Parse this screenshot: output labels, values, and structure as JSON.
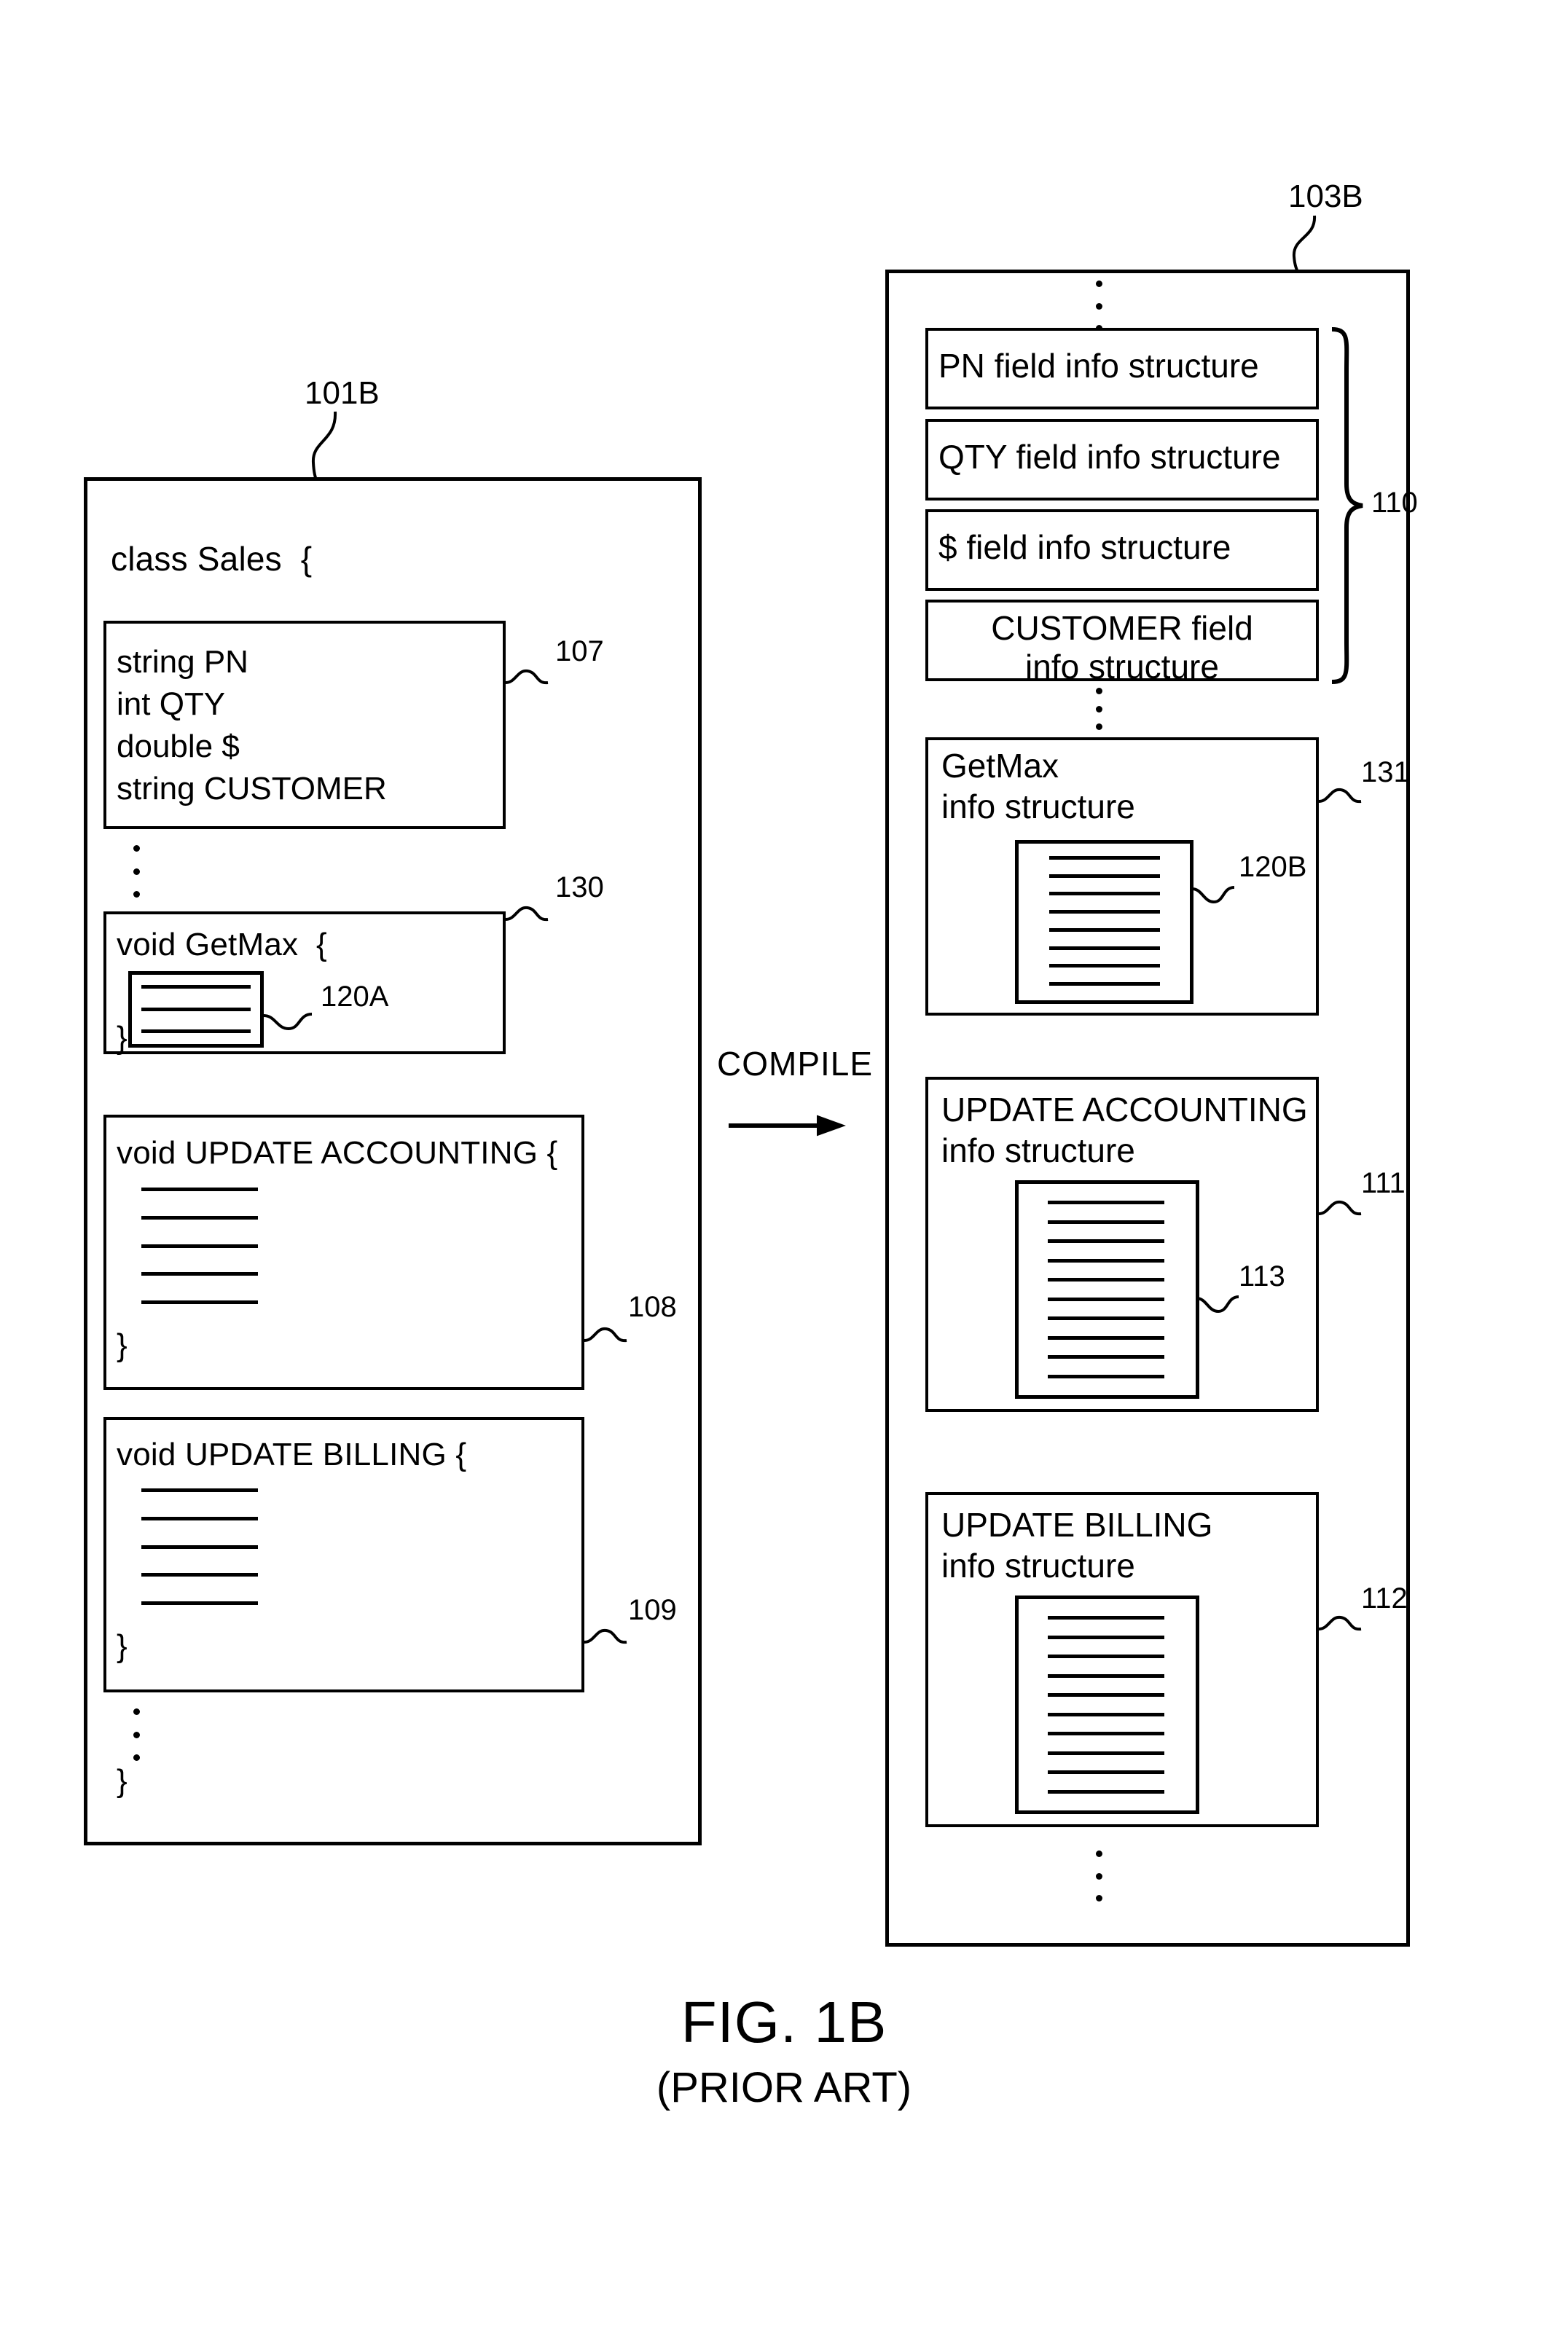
{
  "figure": {
    "caption_main": "FIG. 1B",
    "caption_sub": "(PRIOR ART)",
    "transform_label": "COMPILE"
  },
  "source_panel": {
    "ref": "101B",
    "class_header": "class Sales  {",
    "class_close": "}",
    "fields_block": {
      "ref": "107",
      "lines": [
        "string PN",
        "int QTY",
        "double $",
        "string CUSTOMER"
      ]
    },
    "methods": [
      {
        "ref": "130",
        "header": "void GetMax  {",
        "close": "}",
        "body_ref": "120A",
        "body_line_count": 3
      },
      {
        "ref": "108",
        "header": "void UPDATE ACCOUNTING {",
        "close": "}",
        "body_ref": "",
        "body_line_count": 5
      },
      {
        "ref": "109",
        "header": "void UPDATE BILLING {",
        "close": "}",
        "body_ref": "",
        "body_line_count": 5
      }
    ]
  },
  "compiled_panel": {
    "ref": "103B",
    "field_group": {
      "ref": "110",
      "items": [
        {
          "label": "PN field info structure"
        },
        {
          "label": "QTY field info structure"
        },
        {
          "label": "$ field info structure"
        },
        {
          "label": "CUSTOMER field\ninfo structure"
        }
      ]
    },
    "method_structures": [
      {
        "ref": "131",
        "title_line1": "GetMax",
        "title_line2": "info structure",
        "body_ref": "120B",
        "body_line_count": 8
      },
      {
        "ref": "111",
        "title_line1": "UPDATE ACCOUNTING",
        "title_line2": "info structure",
        "body_ref": "113",
        "body_line_count": 10
      },
      {
        "ref": "112",
        "title_line1": "UPDATE BILLING",
        "title_line2": "info structure",
        "body_ref": "",
        "body_line_count": 10
      }
    ]
  }
}
